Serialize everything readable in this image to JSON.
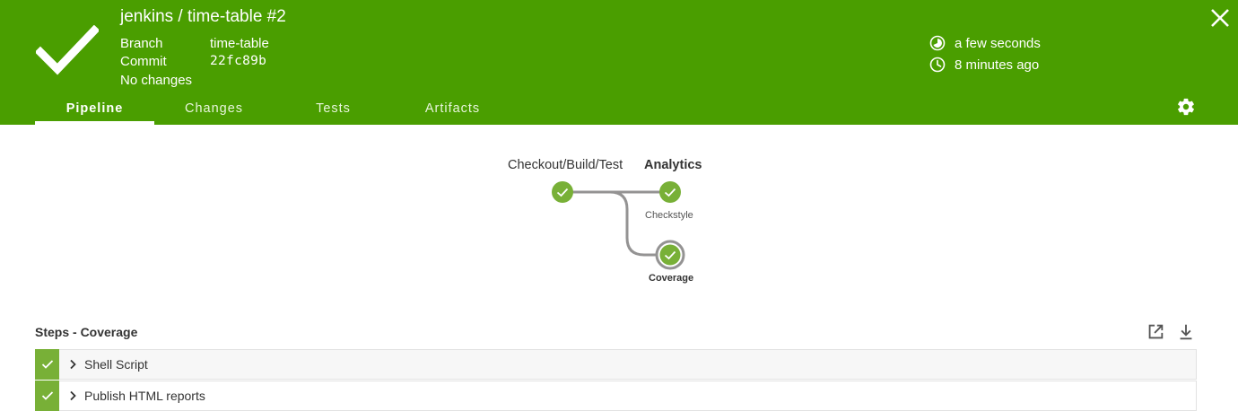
{
  "header": {
    "title": "jenkins / time-table #2",
    "status": "success",
    "branch_label": "Branch",
    "branch_value": "time-table",
    "commit_label": "Commit",
    "commit_value": "22fc89b",
    "changes_text": "No changes",
    "duration": "a few seconds",
    "started": "8 minutes ago",
    "colors": {
      "success_bg": "#4a9e00",
      "node_success": "#78b037"
    }
  },
  "tabs": [
    {
      "label": "Pipeline",
      "active": true
    },
    {
      "label": "Changes",
      "active": false
    },
    {
      "label": "Tests",
      "active": false
    },
    {
      "label": "Artifacts",
      "active": false
    }
  ],
  "pipeline": {
    "stages": [
      {
        "label": "Checkout/Build/Test",
        "selected": false
      },
      {
        "label": "Analytics",
        "selected": true,
        "parallel": [
          {
            "label": "Checkstyle",
            "selected": false
          },
          {
            "label": "Coverage",
            "selected": true
          }
        ]
      }
    ]
  },
  "steps": {
    "title": "Steps - Coverage",
    "items": [
      {
        "label": "Shell Script",
        "status": "success"
      },
      {
        "label": "Publish HTML reports",
        "status": "success"
      }
    ]
  }
}
